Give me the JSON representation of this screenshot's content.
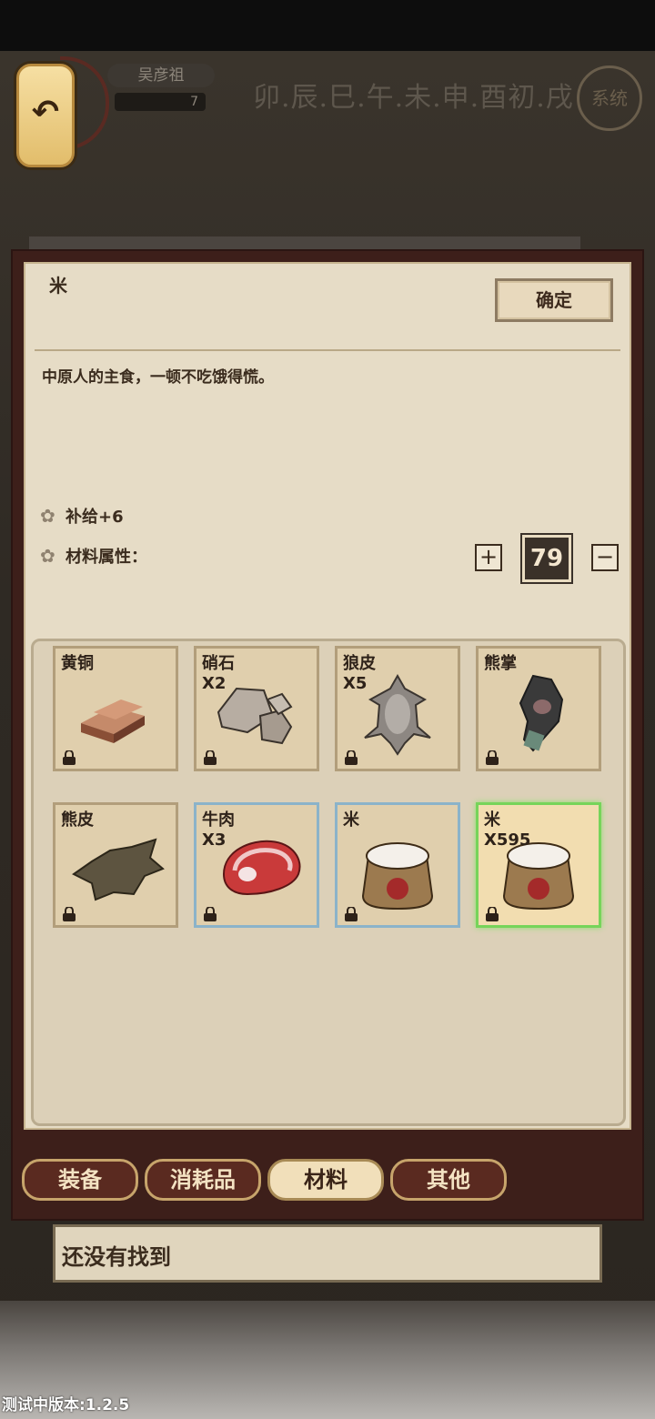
{
  "header": {
    "player_name": "吴彦祖",
    "player_level": "7",
    "time_strip": "卯.辰.巳.午.未.申.酉初.戌",
    "system_label": "系统"
  },
  "detail": {
    "item_name": "米",
    "confirm_label": "确定",
    "description": "中原人的主食，一顿不吃饿得慌。",
    "attr1": "补给+6",
    "attr2": "材料属性：",
    "quantity": "79",
    "plus_symbol": "+",
    "minus_symbol": "−"
  },
  "inventory": [
    {
      "name": "黄铜",
      "count": "",
      "icon": "brass-ingot-icon"
    },
    {
      "name": "硝石",
      "count": "X2",
      "icon": "saltpeter-rock-icon"
    },
    {
      "name": "狼皮",
      "count": "X5",
      "icon": "wolf-pelt-icon"
    },
    {
      "name": "熊掌",
      "count": "",
      "icon": "bear-paw-icon"
    },
    {
      "name": "熊皮",
      "count": "",
      "icon": "bear-pelt-icon"
    },
    {
      "name": "牛肉",
      "count": "X3",
      "icon": "beef-steak-icon"
    },
    {
      "name": "米",
      "count": "",
      "icon": "rice-sack-icon"
    },
    {
      "name": "米",
      "count": "X595",
      "icon": "rice-sack-icon"
    }
  ],
  "tabs": [
    "装备",
    "消耗品",
    "材料",
    "其他"
  ],
  "active_tab": "材料",
  "notice": "还没有找到",
  "version": "测试中版本:1.2.5",
  "colors": {
    "panel_bg": "#e6dcc6",
    "frame_red": "#3d1f1a",
    "selected_green": "#76d45a",
    "rare_blue": "#8bb3c9"
  }
}
